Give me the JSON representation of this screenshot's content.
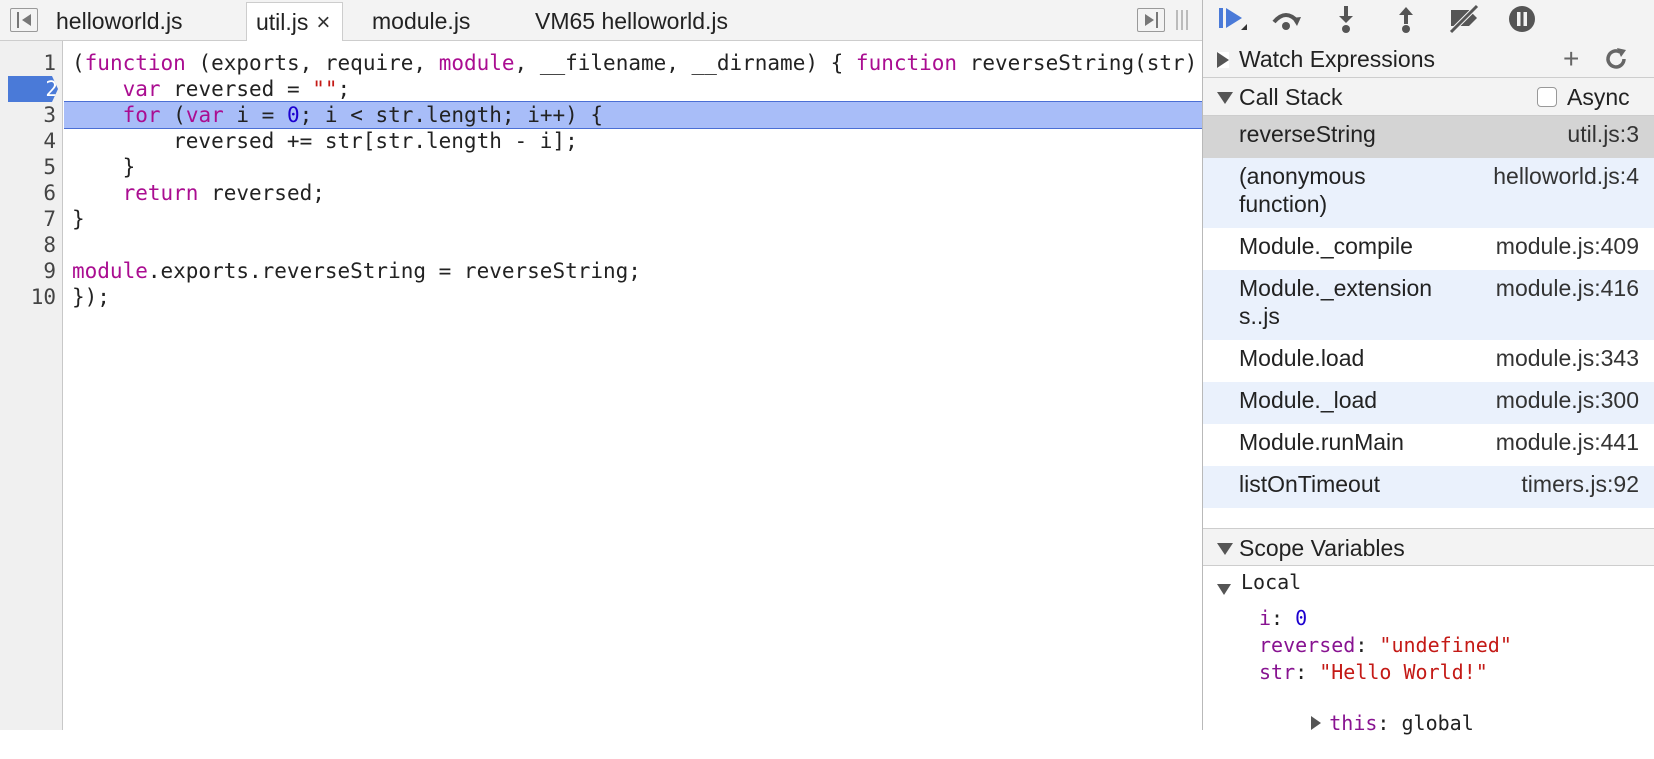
{
  "tabs": [
    {
      "label": "helloworld.js",
      "active": false
    },
    {
      "label": "util.js",
      "active": true,
      "close": "×"
    },
    {
      "label": "module.js",
      "active": false
    },
    {
      "label": "VM65 helloworld.js",
      "active": false
    }
  ],
  "editor": {
    "line_numbers": [
      "1",
      "2",
      "3",
      "4",
      "5",
      "6",
      "7",
      "8",
      "9",
      "10"
    ],
    "breakpoint_line": "2",
    "execution_line": "3"
  },
  "sidebar": {
    "watch": {
      "title": "Watch Expressions"
    },
    "call_stack": {
      "title": "Call Stack",
      "async_label": "Async",
      "frames": [
        {
          "fn": "reverseString",
          "loc": "util.js:3"
        },
        {
          "fn": "(anonymous function)",
          "loc": "helloworld.js:4"
        },
        {
          "fn": "Module._compile",
          "loc": "module.js:409"
        },
        {
          "fn": "Module._extensions..js",
          "loc": "module.js:416"
        },
        {
          "fn": "Module.load",
          "loc": "module.js:343"
        },
        {
          "fn": "Module._load",
          "loc": "module.js:300"
        },
        {
          "fn": "Module.runMain",
          "loc": "module.js:441"
        },
        {
          "fn": "listOnTimeout",
          "loc": "timers.js:92"
        }
      ]
    },
    "scope": {
      "title": "Scope Variables",
      "local_label": "Local",
      "vars": [
        {
          "name": "i",
          "value": "0"
        },
        {
          "name": "reversed",
          "value": "\"undefined\""
        },
        {
          "name": "str",
          "value": "\"Hello World!\""
        },
        {
          "name": "this",
          "value": "global"
        }
      ]
    }
  },
  "colors": {
    "execution_highlight": "#a8bdf8",
    "breakpoint": "#4a7ad8",
    "keyword": "#aa0d91",
    "string": "#c41a16",
    "number": "#1c00cf"
  }
}
